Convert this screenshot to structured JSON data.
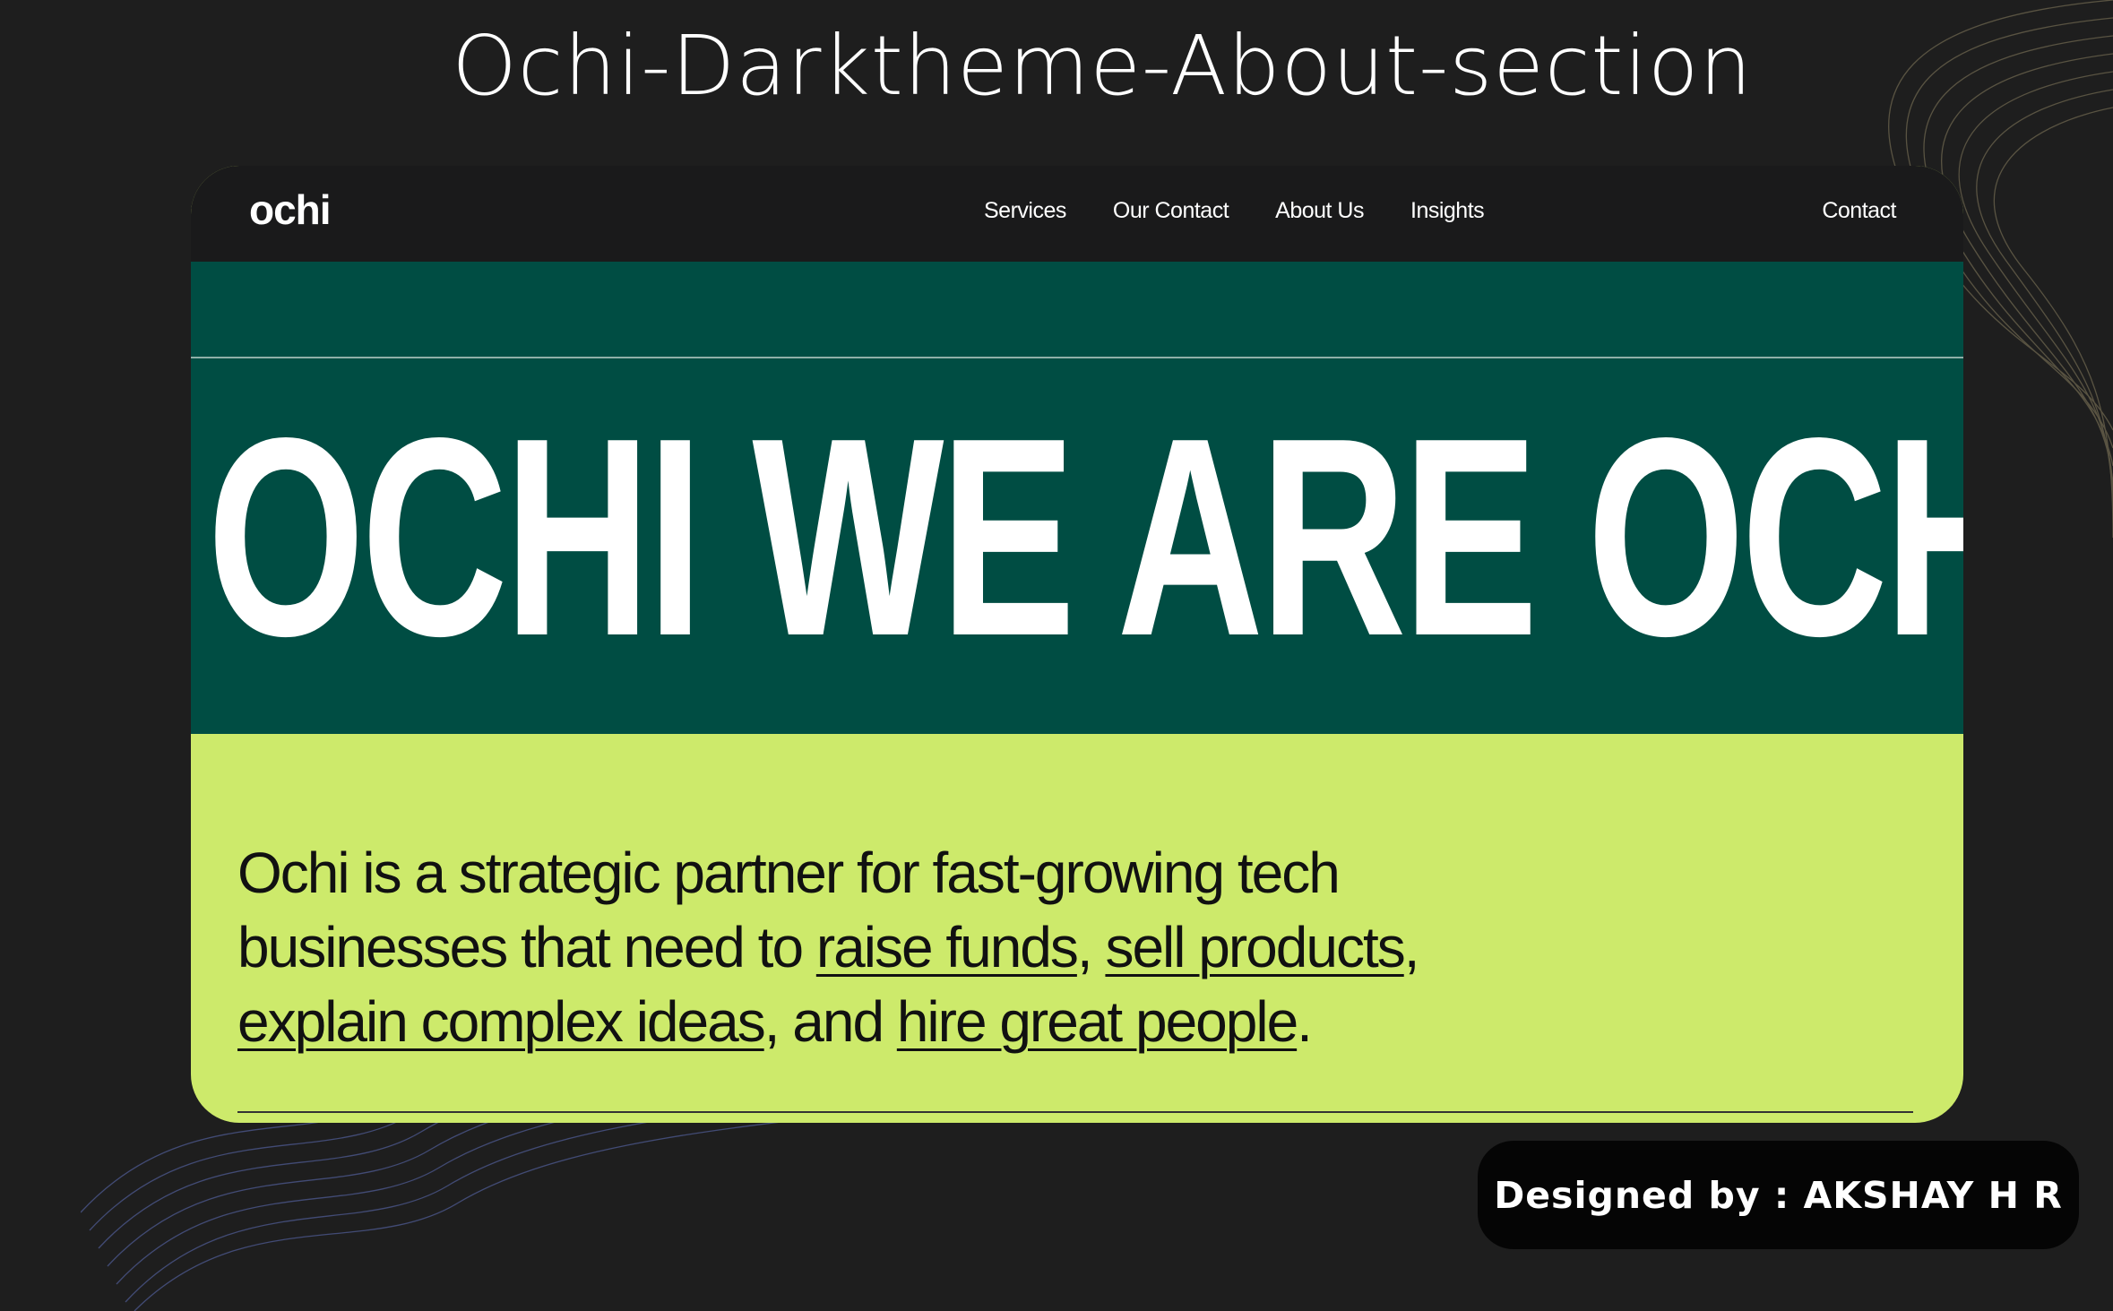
{
  "showcase": {
    "title": "Ochi-Darktheme-About-section",
    "credit": "Designed by : AKSHAY H R"
  },
  "nav": {
    "logo": "ochi",
    "links": [
      "Services",
      "Our Contact",
      "About Us",
      "Insights"
    ],
    "cta": "Contact"
  },
  "hero": {
    "marquee": "OCHI   WE ARE OCHI"
  },
  "about": {
    "text_1": "Ochi is a strategic partner for fast-growing tech businesses that need to ",
    "link_1": "raise funds",
    "sep_1": ", ",
    "link_2": "sell products",
    "sep_2": ", ",
    "link_3": "explain complex ideas",
    "sep_3": ", and ",
    "link_4": "hire great people",
    "end": "."
  },
  "colors": {
    "page_bg": "#1e1e1e",
    "nav_bg": "#1a1a1b",
    "band_green": "#004d43",
    "lime": "#cdea6b"
  }
}
